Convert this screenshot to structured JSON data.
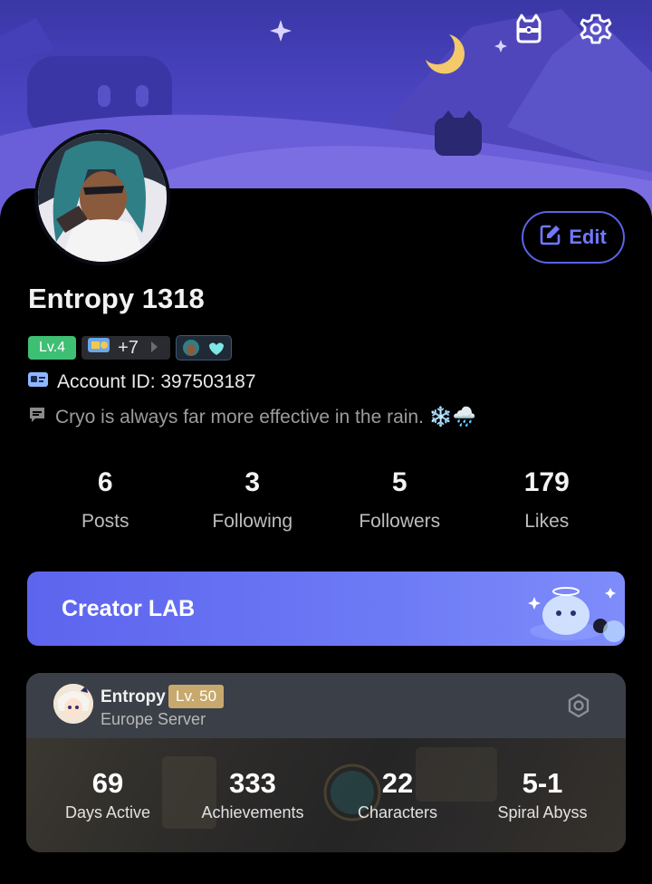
{
  "profile": {
    "username": "Entropy 1318",
    "level_badge": "Lv.4",
    "medals_more": "+7",
    "account_id": "Account ID: 397503187",
    "bio": "Cryo is always far more effective in the rain. ❄️🌧️",
    "edit_label": "Edit"
  },
  "stats": [
    {
      "value": "6",
      "label": "Posts"
    },
    {
      "value": "3",
      "label": "Following"
    },
    {
      "value": "5",
      "label": "Followers"
    },
    {
      "value": "179",
      "label": "Likes"
    }
  ],
  "creator": {
    "label": "Creator LAB"
  },
  "game_card": {
    "name": "Entropy",
    "level": "Lv. 50",
    "server": "Europe Server",
    "stats": [
      {
        "value": "69",
        "label": "Days Active"
      },
      {
        "value": "333",
        "label": "Achievements"
      },
      {
        "value": "22",
        "label": "Characters"
      },
      {
        "value": "5-1",
        "label": "Spiral Abyss"
      }
    ]
  },
  "colors": {
    "accent": "#6f78ff",
    "level_green": "#3fbf74",
    "level_gold": "#c7a96e",
    "creator_bg": "#6470f0"
  },
  "icons": [
    "moon-icon",
    "star-icon",
    "cat-box-icon",
    "gear-icon",
    "edit-icon",
    "id-card-icon",
    "message-icon"
  ]
}
